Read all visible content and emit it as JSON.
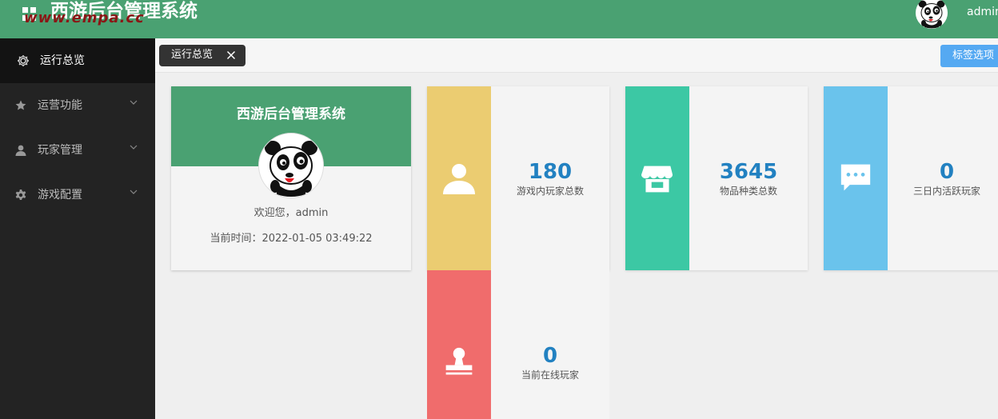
{
  "header": {
    "title": "西游后台管理系统",
    "watermark": "www.empa.cc",
    "username": "admin"
  },
  "sidebar": {
    "items": [
      {
        "label": "运行总览",
        "icon": "gear-icon",
        "active": true
      },
      {
        "label": "运营功能",
        "icon": "star-icon",
        "active": false
      },
      {
        "label": "玩家管理",
        "icon": "user-icon",
        "active": false
      },
      {
        "label": "游戏配置",
        "icon": "cog-icon",
        "active": false
      }
    ]
  },
  "tabs": {
    "active_label": "运行总览",
    "options_label": "标签选项"
  },
  "profile": {
    "title": "西游后台管理系统",
    "welcome": "欢迎您，admin",
    "time": "当前时间：2022-01-05 03:49:22"
  },
  "stats": [
    {
      "value": "180",
      "label": "游戏内玩家总数",
      "color": "#ebcc71",
      "icon": "user-icon"
    },
    {
      "value": "3645",
      "label": "物品种类总数",
      "color": "#3cc8a4",
      "icon": "shop-icon"
    },
    {
      "value": "0",
      "label": "三日内活跃玩家",
      "color": "#6ac3ec",
      "icon": "chat-icon"
    },
    {
      "value": "0",
      "label": "当前在线玩家",
      "color": "#f06c6c",
      "icon": "stamp-icon"
    }
  ],
  "colors": {
    "header_green": "#4aa172",
    "sidebar_dark": "#232323",
    "stat_value_blue": "#2281c1",
    "options_blue": "#55a9f2"
  }
}
